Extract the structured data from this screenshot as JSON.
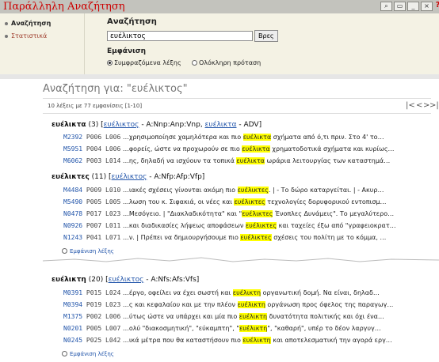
{
  "app": {
    "title": "Παράλληλη Αναζήτηση"
  },
  "window_controls": [
    "Find",
    "Attach",
    "Minimize",
    "Close",
    "?"
  ],
  "sidebar": {
    "items": [
      {
        "label": "Αναζήτηση",
        "active": true
      },
      {
        "label": "Στατιστικά",
        "active": false
      }
    ]
  },
  "search": {
    "title": "Αναζήτηση",
    "query": "ευέλικτος",
    "button": "Βρες",
    "display_title": "Εμφάνιση",
    "options": [
      {
        "label": "Συμφραζόμενα λέξης",
        "selected": true
      },
      {
        "label": "Ολόκληρη πρόταση",
        "selected": false
      }
    ]
  },
  "results": {
    "title": "Αναζήτηση για: \"ευέλικτος\"",
    "count": "10 λέξεις με 77 εμφανίσεις [1-10]",
    "pager": {
      "first": "|<",
      "prev": "<",
      "next": ">",
      "last": ">|"
    },
    "show_more_label": "Εμφάνιση λέξης",
    "groups": [
      {
        "word": "ευέλικτα",
        "count": "(3)",
        "lemma1": "ευέλικτος",
        "tag1": " - A:Nnp:Anp:Vnp, ",
        "lemma2": "ευέλικτα",
        "tag2": " - ADV]",
        "rows": [
          {
            "id": "M2392",
            "p": "P006",
            "l": "L006",
            "left": "…χρησιμοποίησε χαμηλότερα και πιο ",
            "kw": "ευέλικτα",
            "right": " σχήματα από ό,τι πριν. Στο 4' το…"
          },
          {
            "id": "M5951",
            "p": "P004",
            "l": "L006",
            "left": "…φορείς, ώστε να προχωρούν σε πιο ",
            "kw": "ευέλικτα",
            "right": " χρηματοδοτικά σχήματα και κυρίως…"
          },
          {
            "id": "M6062",
            "p": "P003",
            "l": "L014",
            "left": "…ης, δηλαδή να ισχύουν τα τοπικά ",
            "kw": "ευέλικτα",
            "right": " ωράρια λειτουργίας των καταστημά…"
          }
        ]
      },
      {
        "word": "ευέλικτες",
        "count": "(11)",
        "lemma1": "ευέλικτος",
        "tag1": " - A:Nfp:Afp:Vfp]",
        "rows": [
          {
            "id": "M4484",
            "p": "P009",
            "l": "L010",
            "left": "…ιακές σχέσεις γίνονται ακόμη πιο ",
            "kw": "ευέλικτες",
            "right": ". | - Το δώρο καταργείται. | - Ακυρ…"
          },
          {
            "id": "M5490",
            "p": "P005",
            "l": "L005",
            "left": "…λωση του κ. Σιφακιά, οι νέες και ",
            "kw": "ευέλικτες",
            "right": " τεχνολογίες δορυφορικού εντοπισμ…"
          },
          {
            "id": "N0478",
            "p": "P017",
            "l": "L023",
            "left": "…Μεσόγειο. | \"Διακλαδικότητα\" και \"",
            "kw": "ευέλικτες",
            "right": " Ένοπλες Δυνάμεις\". Το μεγαλύτερο…"
          },
          {
            "id": "N0926",
            "p": "P007",
            "l": "L011",
            "left": "…και διαδικασίες λήψεως αποφάσεων ",
            "kw": "ευέλικτες",
            "right": " και ταχείες έξω από \"γραφειοκρατ…"
          },
          {
            "id": "N1243",
            "p": "P041",
            "l": "L071",
            "left": "…ν. | Πρέπει να δημιουργήσουμε πιο ",
            "kw": "ευέλικτες",
            "right": " σχέσεις του πολίτη με το κόμμα, …"
          }
        ]
      },
      {
        "word": "ευέλικτη",
        "count": "(20)",
        "lemma1": "ευέλικτος",
        "tag1": " - A:Nfs:Afs:Vfs]",
        "rows": [
          {
            "id": "M0391",
            "p": "P015",
            "l": "L024",
            "left": "…έργο, οφείλει να έχει σωστή και ",
            "kw": "ευέλικτη",
            "right": " οργανωτική δομή. Να είναι, δηλαδ…"
          },
          {
            "id": "M0394",
            "p": "P019",
            "l": "L023",
            "left": "…ς και κεφαλαίου και με την πλέον ",
            "kw": "ευέλικτη",
            "right": " οργάνωση προς όφελος της παραγωγ…"
          },
          {
            "id": "M1375",
            "p": "P002",
            "l": "L006",
            "left": "…ύτως ώστε να υπάρχει και μία πιο ",
            "kw": "ευέλικτη",
            "right": " δυνατότητα πολιτικής και όχι ένα…"
          },
          {
            "id": "N0201",
            "p": "P005",
            "l": "L007",
            "left": "…ολύ \"διακοσμητική\", \"εύκαμπτη\", \"",
            "kw": "ευέλικτη",
            "right": "\", \"καθαρή\", υπέρ το δέον λαργυγ…"
          },
          {
            "id": "N0245",
            "p": "P025",
            "l": "L042",
            "left": "…ικά μέτρα που θα καταστήσουν πιο ",
            "kw": "ευέλικτη",
            "right": " και αποτελεσματική την αγορά εργ…"
          }
        ]
      }
    ]
  }
}
